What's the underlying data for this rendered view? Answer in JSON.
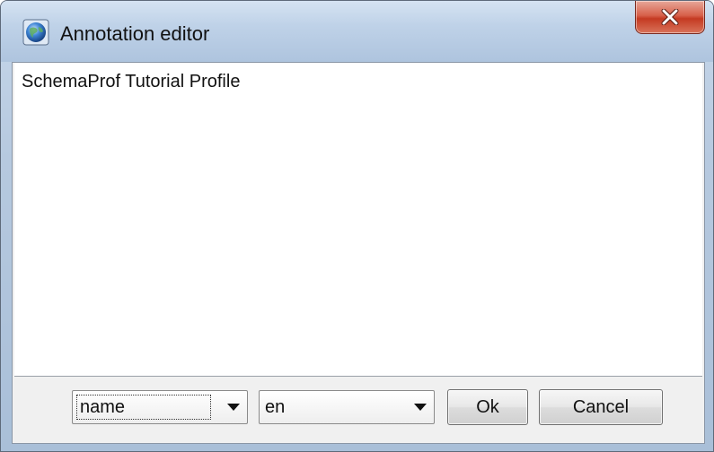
{
  "window": {
    "title": "Annotation editor",
    "icon": "globe-icon",
    "close_icon": "close-icon"
  },
  "editor": {
    "text": "SchemaProf Tutorial Profile"
  },
  "controls": {
    "annotation_type": "name",
    "language": "en",
    "ok_label": "Ok",
    "cancel_label": "Cancel"
  },
  "colors": {
    "close_button": "#c43a22",
    "titlebar": "#bfd2e8"
  }
}
